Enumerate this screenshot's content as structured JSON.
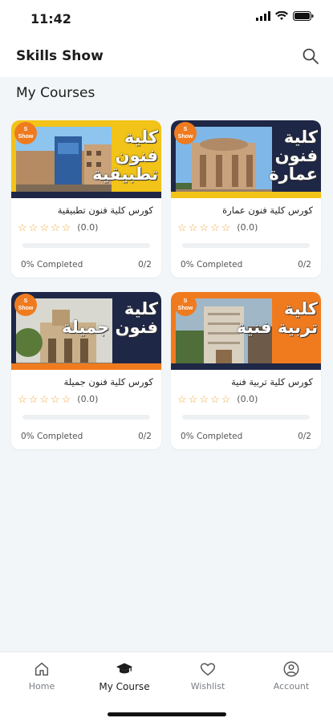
{
  "status": {
    "time": "11:42",
    "icons": [
      "cellular-icon",
      "wifi-icon",
      "battery-icon"
    ]
  },
  "header": {
    "title": "Skills Show",
    "search_icon": "search-icon"
  },
  "section": {
    "title": "My Courses"
  },
  "courses": [
    {
      "name": "كورس كلية فنون تطبيقية",
      "thumb_line1": "كلية",
      "thumb_line2": "فنون تطبيقية",
      "rating": "(0.0)",
      "stars": 0,
      "progress": 0,
      "completed": "0% Completed",
      "count": "0/2",
      "accent": "#f2c318"
    },
    {
      "name": "كورس كلية فنون عمارة",
      "thumb_line1": "كلية",
      "thumb_line2": "فنون عمارة",
      "rating": "(0.0)",
      "stars": 0,
      "progress": 0,
      "completed": "0% Completed",
      "count": "0/2",
      "accent": "#1e2746"
    },
    {
      "name": "كورس كلية فنون جميلة",
      "thumb_line1": "كلية",
      "thumb_line2": "فنون جميلة",
      "rating": "(0.0)",
      "stars": 0,
      "progress": 0,
      "completed": "0% Completed",
      "count": "0/2",
      "accent": "#1e2746"
    },
    {
      "name": "كورس كلية تربية فنية",
      "thumb_line1": "كلية",
      "thumb_line2": "تربية فنية",
      "rating": "(0.0)",
      "stars": 0,
      "progress": 0,
      "completed": "0% Completed",
      "count": "0/2",
      "accent": "#f07b1f"
    }
  ],
  "logo_text": "Skills Show",
  "tabs": [
    {
      "label": "Home",
      "icon": "home-icon",
      "active": false
    },
    {
      "label": "My Course",
      "icon": "graduation-cap-icon",
      "active": true
    },
    {
      "label": "Wishlist",
      "icon": "heart-icon",
      "active": false
    },
    {
      "label": "Account",
      "icon": "account-icon",
      "active": false
    }
  ],
  "colors": {
    "brand_orange": "#f07b1f",
    "star": "#f2a93b",
    "background": "#f3f6f8"
  }
}
